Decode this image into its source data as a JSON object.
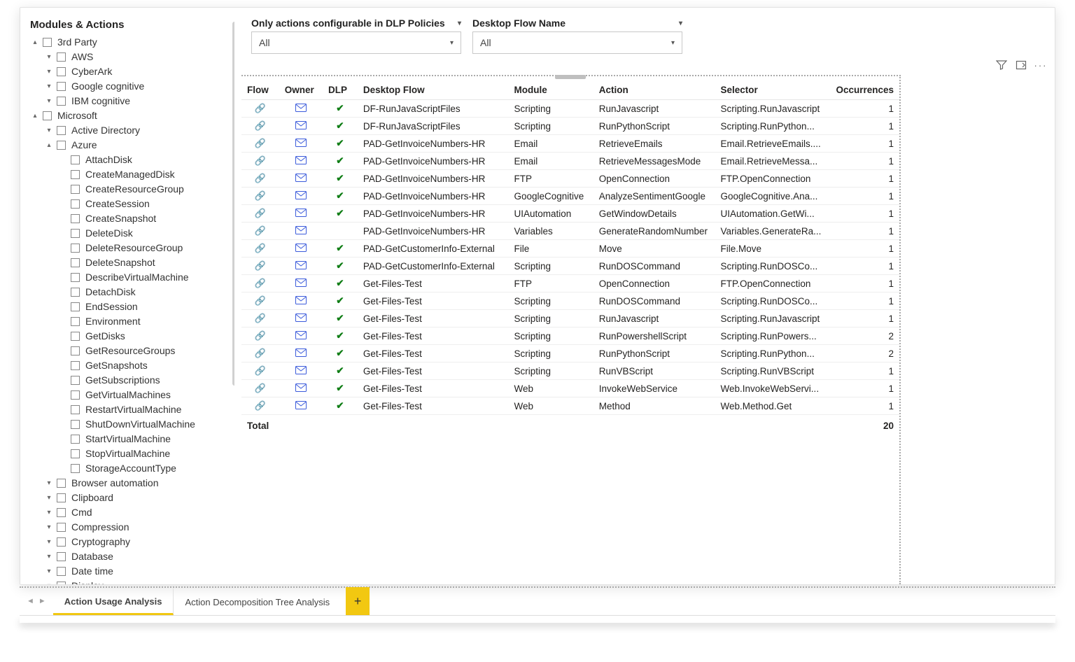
{
  "sidebar": {
    "title": "Modules & Actions",
    "nodes": [
      {
        "level": 1,
        "caret": "up",
        "label": "3rd Party"
      },
      {
        "level": 2,
        "caret": "down",
        "label": "AWS"
      },
      {
        "level": 2,
        "caret": "down",
        "label": "CyberArk"
      },
      {
        "level": 2,
        "caret": "down",
        "label": "Google cognitive"
      },
      {
        "level": 2,
        "caret": "down",
        "label": "IBM cognitive"
      },
      {
        "level": 1,
        "caret": "up",
        "label": "Microsoft"
      },
      {
        "level": 2,
        "caret": "down",
        "label": "Active Directory"
      },
      {
        "level": 2,
        "caret": "up",
        "label": "Azure"
      },
      {
        "level": 3,
        "caret": "",
        "label": "AttachDisk"
      },
      {
        "level": 3,
        "caret": "",
        "label": "CreateManagedDisk"
      },
      {
        "level": 3,
        "caret": "",
        "label": "CreateResourceGroup"
      },
      {
        "level": 3,
        "caret": "",
        "label": "CreateSession"
      },
      {
        "level": 3,
        "caret": "",
        "label": "CreateSnapshot"
      },
      {
        "level": 3,
        "caret": "",
        "label": "DeleteDisk"
      },
      {
        "level": 3,
        "caret": "",
        "label": "DeleteResourceGroup"
      },
      {
        "level": 3,
        "caret": "",
        "label": "DeleteSnapshot"
      },
      {
        "level": 3,
        "caret": "",
        "label": "DescribeVirtualMachine"
      },
      {
        "level": 3,
        "caret": "",
        "label": "DetachDisk"
      },
      {
        "level": 3,
        "caret": "",
        "label": "EndSession"
      },
      {
        "level": 3,
        "caret": "",
        "label": "Environment"
      },
      {
        "level": 3,
        "caret": "",
        "label": "GetDisks"
      },
      {
        "level": 3,
        "caret": "",
        "label": "GetResourceGroups"
      },
      {
        "level": 3,
        "caret": "",
        "label": "GetSnapshots"
      },
      {
        "level": 3,
        "caret": "",
        "label": "GetSubscriptions"
      },
      {
        "level": 3,
        "caret": "",
        "label": "GetVirtualMachines"
      },
      {
        "level": 3,
        "caret": "",
        "label": "RestartVirtualMachine"
      },
      {
        "level": 3,
        "caret": "",
        "label": "ShutDownVirtualMachine"
      },
      {
        "level": 3,
        "caret": "",
        "label": "StartVirtualMachine"
      },
      {
        "level": 3,
        "caret": "",
        "label": "StopVirtualMachine"
      },
      {
        "level": 3,
        "caret": "",
        "label": "StorageAccountType"
      },
      {
        "level": 2,
        "caret": "down",
        "label": "Browser automation"
      },
      {
        "level": 2,
        "caret": "down",
        "label": "Clipboard"
      },
      {
        "level": 2,
        "caret": "down",
        "label": "Cmd"
      },
      {
        "level": 2,
        "caret": "down",
        "label": "Compression"
      },
      {
        "level": 2,
        "caret": "down",
        "label": "Cryptography"
      },
      {
        "level": 2,
        "caret": "down",
        "label": "Database"
      },
      {
        "level": 2,
        "caret": "down",
        "label": "Date time"
      },
      {
        "level": 2,
        "caret": "down",
        "label": "Display"
      }
    ]
  },
  "filters": {
    "dlp": {
      "label": "Only actions configurable in DLP Policies",
      "value": "All"
    },
    "flow": {
      "label": "Desktop Flow Name",
      "value": "All"
    }
  },
  "table": {
    "headers": {
      "flow": "Flow",
      "owner": "Owner",
      "dlp": "DLP",
      "desktop": "Desktop Flow",
      "module": "Module",
      "action": "Action",
      "selector": "Selector",
      "occ": "Occurrences"
    },
    "rows": [
      {
        "dlp": true,
        "desktop": "DF-RunJavaScriptFiles",
        "module": "Scripting",
        "action": "RunJavascript",
        "selector": "Scripting.RunJavascript",
        "occ": "1"
      },
      {
        "dlp": true,
        "desktop": "DF-RunJavaScriptFiles",
        "module": "Scripting",
        "action": "RunPythonScript",
        "selector": "Scripting.RunPython...",
        "occ": "1"
      },
      {
        "dlp": true,
        "desktop": "PAD-GetInvoiceNumbers-HR",
        "module": "Email",
        "action": "RetrieveEmails",
        "selector": "Email.RetrieveEmails....",
        "occ": "1"
      },
      {
        "dlp": true,
        "desktop": "PAD-GetInvoiceNumbers-HR",
        "module": "Email",
        "action": "RetrieveMessagesMode",
        "selector": "Email.RetrieveMessa...",
        "occ": "1"
      },
      {
        "dlp": true,
        "desktop": "PAD-GetInvoiceNumbers-HR",
        "module": "FTP",
        "action": "OpenConnection",
        "selector": "FTP.OpenConnection",
        "occ": "1"
      },
      {
        "dlp": true,
        "desktop": "PAD-GetInvoiceNumbers-HR",
        "module": "GoogleCognitive",
        "action": "AnalyzeSentimentGoogle",
        "selector": "GoogleCognitive.Ana...",
        "occ": "1"
      },
      {
        "dlp": true,
        "desktop": "PAD-GetInvoiceNumbers-HR",
        "module": "UIAutomation",
        "action": "GetWindowDetails",
        "selector": "UIAutomation.GetWi...",
        "occ": "1"
      },
      {
        "dlp": false,
        "desktop": "PAD-GetInvoiceNumbers-HR",
        "module": "Variables",
        "action": "GenerateRandomNumber",
        "selector": "Variables.GenerateRa...",
        "occ": "1"
      },
      {
        "dlp": true,
        "desktop": "PAD-GetCustomerInfo-External",
        "module": "File",
        "action": "Move",
        "selector": "File.Move",
        "occ": "1"
      },
      {
        "dlp": true,
        "desktop": "PAD-GetCustomerInfo-External",
        "module": "Scripting",
        "action": "RunDOSCommand",
        "selector": "Scripting.RunDOSCo...",
        "occ": "1"
      },
      {
        "dlp": true,
        "desktop": "Get-Files-Test",
        "module": "FTP",
        "action": "OpenConnection",
        "selector": "FTP.OpenConnection",
        "occ": "1"
      },
      {
        "dlp": true,
        "desktop": "Get-Files-Test",
        "module": "Scripting",
        "action": "RunDOSCommand",
        "selector": "Scripting.RunDOSCo...",
        "occ": "1"
      },
      {
        "dlp": true,
        "desktop": "Get-Files-Test",
        "module": "Scripting",
        "action": "RunJavascript",
        "selector": "Scripting.RunJavascript",
        "occ": "1"
      },
      {
        "dlp": true,
        "desktop": "Get-Files-Test",
        "module": "Scripting",
        "action": "RunPowershellScript",
        "selector": "Scripting.RunPowers...",
        "occ": "2"
      },
      {
        "dlp": true,
        "desktop": "Get-Files-Test",
        "module": "Scripting",
        "action": "RunPythonScript",
        "selector": "Scripting.RunPython...",
        "occ": "2"
      },
      {
        "dlp": true,
        "desktop": "Get-Files-Test",
        "module": "Scripting",
        "action": "RunVBScript",
        "selector": "Scripting.RunVBScript",
        "occ": "1"
      },
      {
        "dlp": true,
        "desktop": "Get-Files-Test",
        "module": "Web",
        "action": "InvokeWebService",
        "selector": "Web.InvokeWebServi...",
        "occ": "1"
      },
      {
        "dlp": true,
        "desktop": "Get-Files-Test",
        "module": "Web",
        "action": "Method",
        "selector": "Web.Method.Get",
        "occ": "1"
      }
    ],
    "total_label": "Total",
    "total_value": "20"
  },
  "tabs": {
    "items": [
      {
        "label": "Action Usage Analysis",
        "active": true
      },
      {
        "label": "Action Decomposition Tree Analysis",
        "active": false
      }
    ],
    "add": "+"
  }
}
